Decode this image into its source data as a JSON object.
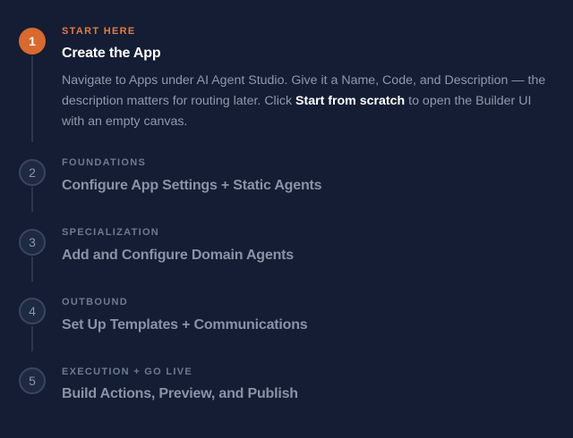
{
  "steps": [
    {
      "number": "1",
      "eyebrow": "START HERE",
      "title": "Create the App",
      "description": {
        "before": "Navigate to Apps under AI Agent Studio. Give it a Name, Code, and Description — the description matters for routing later. Click ",
        "emphasis": "Start from scratch",
        "after": " to open the Builder UI with an empty canvas."
      },
      "state": "active"
    },
    {
      "number": "2",
      "eyebrow": "FOUNDATIONS",
      "title": "Configure App Settings + Static Agents",
      "state": "inactive"
    },
    {
      "number": "3",
      "eyebrow": "SPECIALIZATION",
      "title": "Add and Configure Domain Agents",
      "state": "inactive"
    },
    {
      "number": "4",
      "eyebrow": "OUTBOUND",
      "title": "Set Up Templates + Communications",
      "state": "inactive"
    },
    {
      "number": "5",
      "eyebrow": "EXECUTION + GO LIVE",
      "title": "Build Actions, Preview, and Publish",
      "state": "inactive"
    }
  ],
  "colors": {
    "background": "#141d33",
    "accent": "#d9692e",
    "inactive_circle_border": "#3a4660"
  }
}
